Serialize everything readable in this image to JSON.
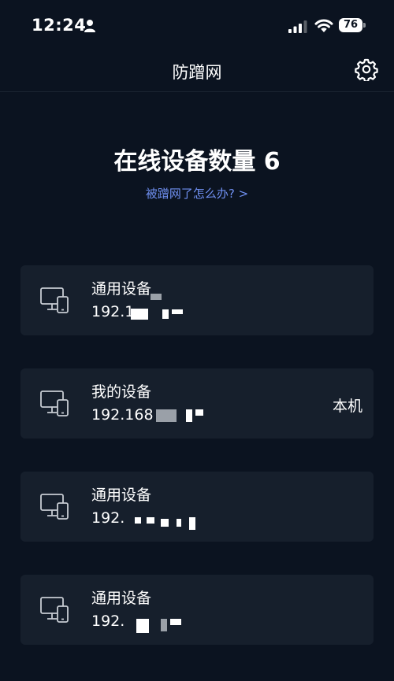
{
  "status_bar": {
    "time": "12:24",
    "battery": "76"
  },
  "nav": {
    "title": "防蹭网"
  },
  "header": {
    "online_count": "在线设备数量 6",
    "help_link": "被蹭网了怎么办? >"
  },
  "devices": [
    {
      "name": "通用设备",
      "ip": "192.1",
      "tag": ""
    },
    {
      "name": "我的设备",
      "ip": "192.168",
      "tag": "本机"
    },
    {
      "name": "通用设备",
      "ip": "192.",
      "tag": ""
    },
    {
      "name": "通用设备",
      "ip": "192.",
      "tag": ""
    }
  ]
}
